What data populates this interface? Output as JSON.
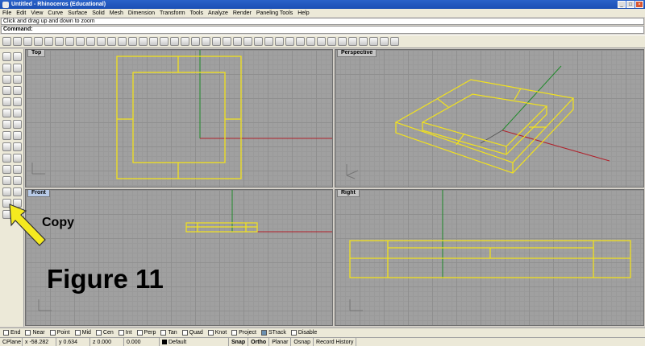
{
  "window": {
    "title": "Untitled - Rhinoceros (Educational)"
  },
  "menu": [
    "File",
    "Edit",
    "View",
    "Curve",
    "Surface",
    "Solid",
    "Mesh",
    "Dimension",
    "Transform",
    "Tools",
    "Analyze",
    "Render",
    "Paneling Tools",
    "Help"
  ],
  "command": {
    "history": "Click and drag up and down to zoom",
    "prompt": "Command:"
  },
  "viewports": {
    "top": "Top",
    "perspective": "Perspective",
    "front": "Front",
    "right": "Right"
  },
  "annotations": {
    "copy": "Copy",
    "figure": "Figure 11"
  },
  "osnap": [
    {
      "label": "End",
      "checked": false
    },
    {
      "label": "Near",
      "checked": false
    },
    {
      "label": "Point",
      "checked": false
    },
    {
      "label": "Mid",
      "checked": false
    },
    {
      "label": "Cen",
      "checked": false
    },
    {
      "label": "Int",
      "checked": false
    },
    {
      "label": "Perp",
      "checked": false
    },
    {
      "label": "Tan",
      "checked": false
    },
    {
      "label": "Quad",
      "checked": false
    },
    {
      "label": "Knot",
      "checked": false
    },
    {
      "label": "Project",
      "checked": false
    },
    {
      "label": "STrack",
      "checked": true
    },
    {
      "label": "Disable",
      "checked": false
    }
  ],
  "status": {
    "cplane": "CPlane",
    "x": "x -58.282",
    "y": "y 0.634",
    "z": "z 0.000",
    "extra": "0.000",
    "layer": "Default",
    "snap": "Snap",
    "ortho": "Ortho",
    "planar": "Planar",
    "osnap": "Osnap",
    "history": "Record History"
  },
  "colors": {
    "geometry": "#f2e21d",
    "x_axis": "#b0202a",
    "y_axis": "#1f8a2a",
    "arrow": "#f5ea1f"
  }
}
